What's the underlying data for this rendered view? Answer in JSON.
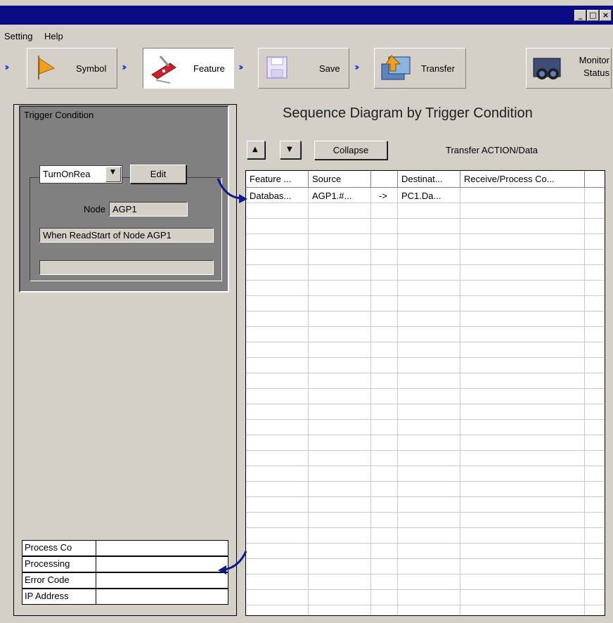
{
  "window": {
    "minimize_glyph": "_",
    "maximize_glyph": "□",
    "close_glyph": "×"
  },
  "menu": [
    "Setting",
    "Help"
  ],
  "steps": [
    {
      "label": "Symbol",
      "icon": "flag-icon"
    },
    {
      "label": "Feature",
      "icon": "swiss-knife-icon"
    },
    {
      "label": "Save",
      "icon": "floppy-icon"
    },
    {
      "label": "Transfer",
      "icon": "transfer-icon"
    }
  ],
  "monitor": {
    "line1": "Monitor",
    "line2": "Status",
    "icon": "binoculars-icon"
  },
  "trigger": {
    "title": "Trigger Condition",
    "dropdown_value": "TurnOnRea",
    "edit_label": "Edit",
    "node_label": "Node",
    "node_value": "AGP1",
    "description": "When ReadStart of Node AGP1",
    "extra_value": ""
  },
  "status": [
    {
      "label": "Process Co",
      "value": ""
    },
    {
      "label": "Processing",
      "value": ""
    },
    {
      "label": "Error Code",
      "value": ""
    },
    {
      "label": "IP Address",
      "value": ""
    }
  ],
  "diagram": {
    "title": "Sequence Diagram by Trigger Condition",
    "up_glyph": "▲",
    "down_glyph": "▼",
    "collapse_label": "Collapse",
    "transfer_label": "Transfer ACTION/Data"
  },
  "table": {
    "headers": [
      "Feature ...",
      "Source",
      "",
      "Destinat...",
      "Receive/Process Co...",
      ""
    ],
    "rows": [
      [
        "Databas...",
        "AGP1.#...",
        "->",
        "PC1.Da...",
        "",
        ""
      ]
    ]
  },
  "colors": {
    "titlebar": "#0a0a84",
    "chevron": "#1e3cdc",
    "arrow": "#0b1a8c",
    "face": "#d4d0c8"
  }
}
